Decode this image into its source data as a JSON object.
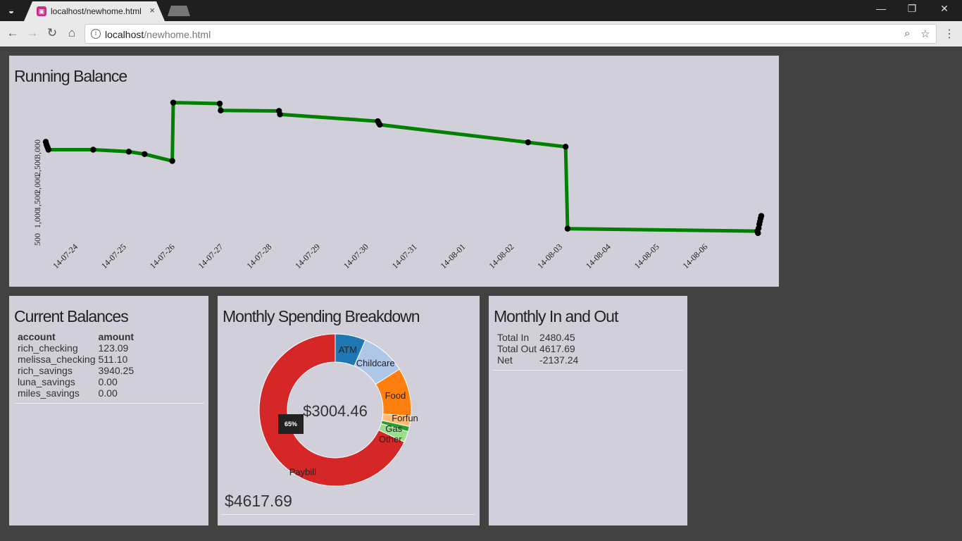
{
  "browser": {
    "tab_title": "localhost/newhome.html",
    "tab_close": "×",
    "url_host": "localhost",
    "url_path": "/newhome.html",
    "win_min": "—",
    "win_max": "❐",
    "win_close": "✕"
  },
  "running_balance": {
    "title": "Running Balance",
    "y_ticks": [
      "500",
      "1,000",
      "1,500",
      "2,000",
      "2,500",
      "3,000"
    ],
    "x_ticks": [
      "14-07-24",
      "14-07-25",
      "14-07-26",
      "14-07-27",
      "14-07-28",
      "14-07-29",
      "14-07-30",
      "14-07-31",
      "14-08-01",
      "14-08-02",
      "14-08-03",
      "14-08-04",
      "14-08-05",
      "14-08-06"
    ],
    "line_color": "#008000"
  },
  "chart_data": [
    {
      "type": "line",
      "title": "Running Balance",
      "xlabel": "",
      "ylabel": "",
      "ylim": [
        400,
        3200
      ],
      "x": [
        "2014-07-23T00:00",
        "2014-07-23T00:20",
        "2014-07-23T00:40",
        "2014-07-23T01:00",
        "2014-07-23T01:20",
        "2014-07-24T00:00",
        "2014-07-24T18:00",
        "2014-07-25T02:00",
        "2014-07-25T16:00",
        "2014-07-25T16:30",
        "2014-07-26T16:00",
        "2014-07-26T16:30",
        "2014-07-27T22:00",
        "2014-07-27T22:30",
        "2014-07-30T00:00",
        "2014-07-30T00:30",
        "2014-07-30T01:00",
        "2014-08-02T04:00",
        "2014-08-02T23:00",
        "2014-08-03T00:00",
        "2014-08-07T00:00",
        "2014-08-07T00:20",
        "2014-08-07T00:40",
        "2014-08-07T01:00",
        "2014-08-07T01:20",
        "2014-08-07T01:40",
        "2014-08-07T02:00"
      ],
      "values": [
        2520,
        2470,
        2430,
        2400,
        2360,
        2360,
        2320,
        2270,
        2130,
        3320,
        3300,
        3160,
        3150,
        3080,
        2940,
        2900,
        2870,
        2510,
        2420,
        750,
        700,
        660,
        760,
        840,
        900,
        960,
        1010
      ]
    },
    {
      "type": "pie",
      "title": "Monthly Spending Breakdown",
      "categories": [
        "ATM",
        "Childcare",
        "Food",
        "Forfun",
        "Gas",
        "Other",
        "Paybill"
      ],
      "values": [
        6.5,
        9.5,
        10.3,
        2.2,
        1.1,
        2.3,
        68.1
      ],
      "colors": [
        "#1f77b4",
        "#aec7e8",
        "#ff7f0e",
        "#ffbb78",
        "#2ca02c",
        "#98df8a",
        "#d62728"
      ]
    }
  ],
  "balances": {
    "title": "Current Balances",
    "headers": [
      "account",
      "amount"
    ],
    "rows": [
      [
        "rich_checking",
        "123.09"
      ],
      [
        "melissa_checking",
        "511.10"
      ],
      [
        "rich_savings",
        "3940.25"
      ],
      [
        "luna_savings",
        "0.00"
      ],
      [
        "miles_savings",
        "0.00"
      ]
    ]
  },
  "spending": {
    "title": "Monthly Spending Breakdown",
    "center_label": "$3004.46",
    "total": "$4617.69",
    "tooltip": "65%"
  },
  "inout": {
    "title": "Monthly In and Out",
    "rows": [
      [
        "Total In",
        "2480.45"
      ],
      [
        "Total Out",
        "4617.69"
      ],
      [
        "Net",
        "-2137.24"
      ]
    ]
  }
}
